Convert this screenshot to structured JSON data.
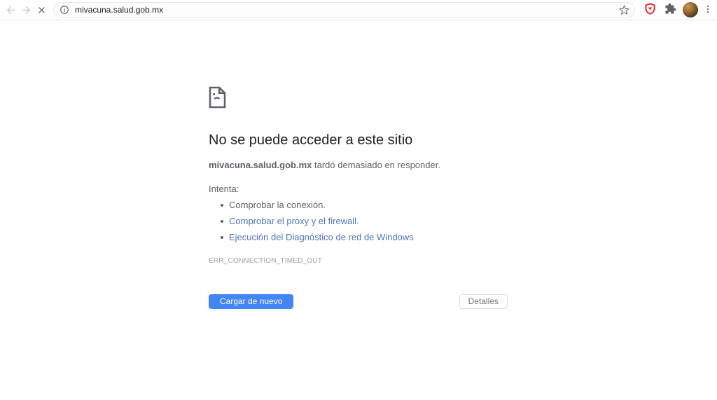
{
  "browser": {
    "omnibox": {
      "url": "mivacuna.salud.gob.mx"
    },
    "icons": {
      "back": "arrow-left",
      "forward": "arrow-right",
      "stop": "close-x",
      "site_info": "info-circle",
      "bookmark": "star-outline",
      "adblock": "red-shield",
      "extensions": "puzzle-piece",
      "profile": "avatar-photo",
      "menu": "kebab-vertical"
    }
  },
  "error_page": {
    "icon": "sad-file",
    "title": "No se puede acceder a este sitio",
    "subtitle_domain": "mivacuna.salud.gob.mx",
    "subtitle_rest": " tardó demasiado en responder.",
    "suggestions_label": "Intenta:",
    "suggestions": [
      {
        "label": "Comprobar la conexión.",
        "is_link": false
      },
      {
        "label": "Comprobar el proxy y el firewall.",
        "is_link": true
      },
      {
        "label": "Ejecución del Diagnóstico de red de Windows",
        "is_link": true
      }
    ],
    "error_code": "ERR_CONNECTION_TIMED_OUT",
    "reload_button_label": "Cargar de nuevo",
    "details_button_label": "Detalles"
  },
  "colors": {
    "accent_blue": "#4285f4",
    "link_blue": "#5073b8",
    "text_dark": "#202124",
    "text_gray": "#5f6368",
    "code_gray": "#9aa0a6",
    "shield_red": "#d7312c",
    "icon_gray": "#5f6368",
    "disabled_gray": "#c4c7cb"
  }
}
